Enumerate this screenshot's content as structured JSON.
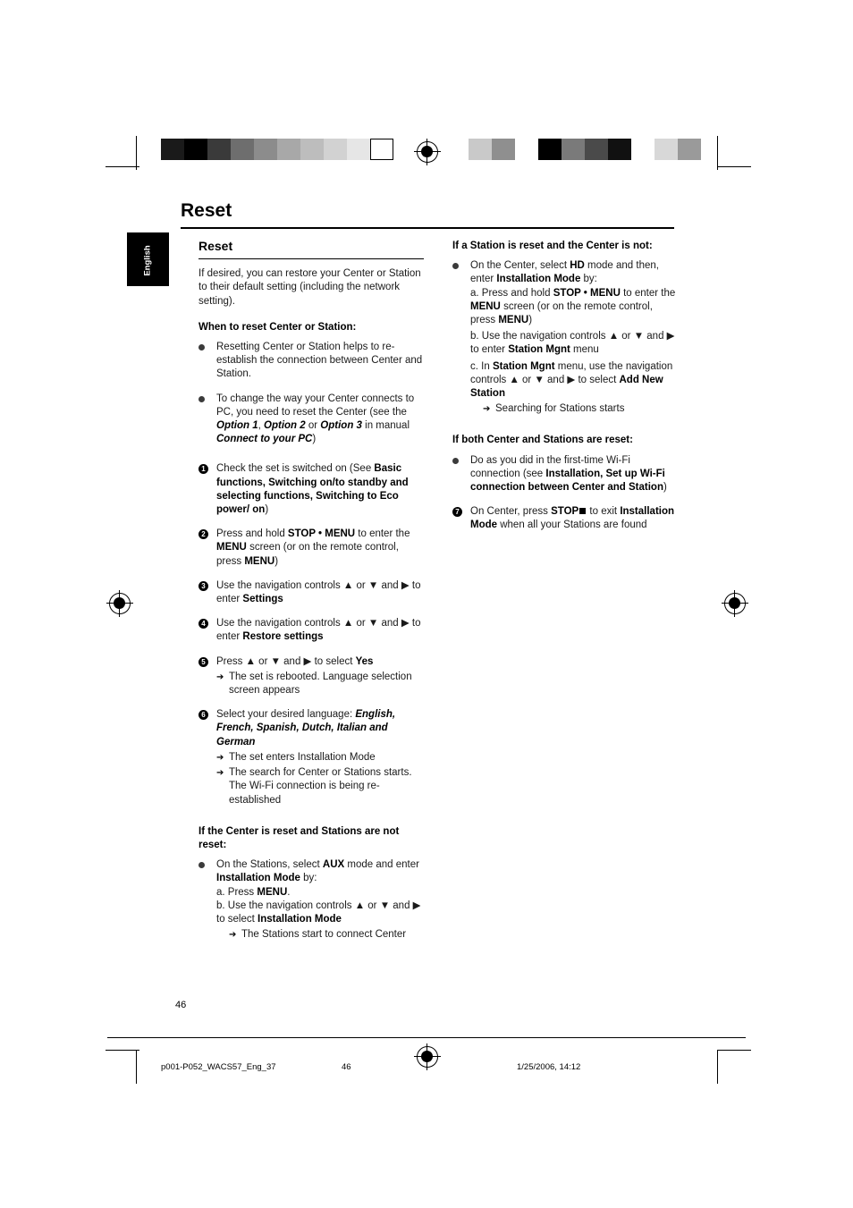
{
  "page": {
    "title": "Reset",
    "language_tab": "English",
    "page_number": "46",
    "footer": {
      "file": "p001-P052_WACS57_Eng_37",
      "page": "46",
      "date": "1/25/2006, 14:12"
    }
  },
  "left": {
    "section_heading": "Reset",
    "intro": "If desired, you can restore your Center or Station to their default setting (including the network setting).",
    "sub1": "When to reset Center or Station:",
    "b1": "Resetting Center or Station helps to re-establish the connection between Center and Station.",
    "b2_part1": "To change the way your Center connects to PC, you need to reset the Center (see the ",
    "b2_opt1": "Option 1",
    "b2_sep1": ", ",
    "b2_opt2": "Option 2",
    "b2_sep2": " or ",
    "b2_opt3": "Option 3",
    "b2_part2": " in manual ",
    "b2_manual": "Connect to your PC",
    "b2_end": ")",
    "steps": [
      {
        "num": "1",
        "t1": "Check the set is switched on (See ",
        "bold": "Basic functions, Switching on/to standby and selecting functions, Switching to Eco power/ on",
        "t2": ")"
      },
      {
        "num": "2",
        "t1": "Press and hold ",
        "bold": "STOP • MENU",
        "t2": " to enter the ",
        "bold2": "MENU",
        "t3": " screen (or on the remote control, press ",
        "bold3": "MENU",
        "t4": ")"
      },
      {
        "num": "3",
        "t1": "Use the navigation controls ▲ or ▼ and ▶ to enter ",
        "bold": "Settings"
      },
      {
        "num": "4",
        "t1": "Use the navigation controls ▲ or ▼ and ▶ to enter ",
        "bold": "Restore settings"
      },
      {
        "num": "5",
        "t1": "Press ▲ or ▼ and ▶ to select ",
        "bold": "Yes",
        "arrow": "The set is rebooted. Language selection screen appears"
      },
      {
        "num": "6",
        "t1": "Select your desired language: ",
        "bolditalic": "English, French, Spanish, Dutch, Italian and German",
        "arrow1": "The set enters Installation Mode",
        "arrow2": "The search for Center or Stations starts. The Wi-Fi connection is being re-established"
      }
    ],
    "sub2": "If the Center is reset and Stations are not reset:",
    "b3_t1": "On the Stations, select ",
    "b3_aux": "AUX",
    "b3_t2": " mode and enter ",
    "b3_inst": "Installation Mode",
    "b3_t3": " by:",
    "b3_a1": "a. Press ",
    "b3_a1b": "MENU",
    "b3_a1e": ".",
    "b3_b1": "b. Use the navigation controls ▲ or ▼ and ▶ to select ",
    "b3_b1b": "Installation Mode",
    "b3_arrow": "The Stations start to connect Center"
  },
  "right": {
    "sub1": "If a Station is reset and the Center is not:",
    "b1_t1": "On the Center, select ",
    "b1_hd": "HD",
    "b1_t2": " mode and then, enter ",
    "b1_inst": "Installation Mode",
    "b1_t3": " by:",
    "b1_a_t1": "a. Press and hold ",
    "b1_a_b1": "STOP • MENU",
    "b1_a_t2": " to enter the ",
    "b1_a_b2": "MENU",
    "b1_a_t3": " screen (or on the remote control, press ",
    "b1_a_b3": "MENU",
    "b1_a_t4": ")",
    "b1_b_t1": "b. Use the navigation controls ▲ or ▼ and ▶ to enter ",
    "b1_b_b1": "Station Mgnt",
    "b1_b_t2": " menu",
    "b1_c_t1": "c.  In ",
    "b1_c_b1": "Station Mgnt",
    "b1_c_t2": " menu,  use the navigation controls ▲ or ▼ and ▶ to select ",
    "b1_c_b2": "Add New Station",
    "b1_arrow": "Searching for Stations starts",
    "sub2": "If both Center and Stations are reset:",
    "b2_t1": "Do as you did in the first-time Wi-Fi connection (see ",
    "b2_b1": "Installation, Set up Wi-Fi connection between Center and Station",
    "b2_t2": ")",
    "step7_num": "7",
    "step7_t1": "On Center, press ",
    "step7_b1": "STOP",
    "step7_t2": " to exit ",
    "step7_b2": "Installation Mode",
    "step7_t3": " when all your Stations are found"
  },
  "marks": {
    "swatch_left": [
      "#1a1a1a",
      "#000000",
      "#3a3a3a",
      "#6e6e6e",
      "#8c8c8c",
      "#a8a8a8",
      "#bdbdbd",
      "#d2d2d2",
      "#e6e6e6",
      "#ffffff"
    ],
    "swatch_right": [
      "#c9c9c9",
      "#8f8f8f",
      "#ffffff",
      "#000000",
      "#7a7a7a",
      "#4a4a4a",
      "#111111",
      "#ffffff",
      "#d8d8d8",
      "#9a9a9a"
    ]
  }
}
